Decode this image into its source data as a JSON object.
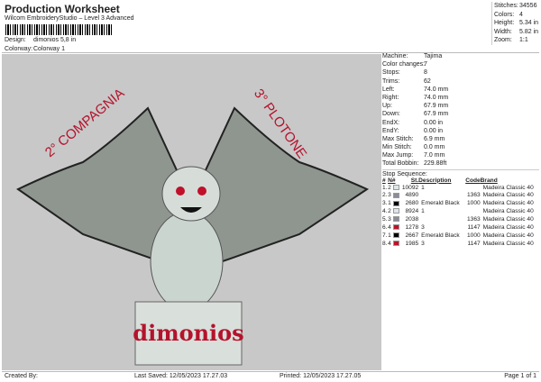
{
  "header": {
    "title": "Production Worksheet",
    "subtitle": "Wilcom EmbroideryStudio – Level 3 Advanced",
    "design_label": "Design:",
    "design": "dimonios 5,8 in",
    "colorway_label": "Colorway:",
    "colorway": "Colorway 1"
  },
  "stats": [
    {
      "k": "Stitches:",
      "v": "34556"
    },
    {
      "k": "Colors:",
      "v": "4"
    },
    {
      "k": "Height:",
      "v": "5.34 in"
    },
    {
      "k": "Width:",
      "v": "5.82 in"
    },
    {
      "k": "Zoom:",
      "v": "1:1"
    }
  ],
  "info": [
    {
      "k": "Machine:",
      "v": "Tajima"
    },
    {
      "k": "Color changes:",
      "v": "7"
    },
    {
      "k": "Stops:",
      "v": "8"
    },
    {
      "k": "Trims:",
      "v": "62"
    },
    {
      "k": "Left:",
      "v": "74.0 mm"
    },
    {
      "k": "Right:",
      "v": "74.0 mm"
    },
    {
      "k": "Up:",
      "v": "67.9 mm"
    },
    {
      "k": "Down:",
      "v": "67.9 mm"
    },
    {
      "k": "EndX:",
      "v": "0.00 in"
    },
    {
      "k": "EndY:",
      "v": "0.00 in"
    },
    {
      "k": "Max Stitch:",
      "v": "6.9 mm"
    },
    {
      "k": "Min Stitch:",
      "v": "0.0 mm"
    },
    {
      "k": "Max Jump:",
      "v": "7.0 mm"
    },
    {
      "k": "Total Bobbin:",
      "v": "229.88ft"
    }
  ],
  "stop_sequence": {
    "label": "Stop Sequence:",
    "columns": [
      "#",
      "N#",
      "St.",
      "Description",
      "Code",
      "Brand"
    ],
    "rows": [
      {
        "n": "1.",
        "nn": "2",
        "color": "#dde6ea",
        "st": "10092",
        "desc": "1",
        "code": "",
        "brand": "Madeira Classic 40"
      },
      {
        "n": "2.",
        "nn": "3",
        "color": "#8a8e9a",
        "st": "4890",
        "desc": "",
        "code": "1363",
        "brand": "Madeira Classic 40"
      },
      {
        "n": "3.",
        "nn": "1",
        "color": "#000000",
        "st": "2680",
        "desc": "Emerald Black",
        "code": "1000",
        "brand": "Madeira Classic 40"
      },
      {
        "n": "4.",
        "nn": "2",
        "color": "#dde6ea",
        "st": "8924",
        "desc": "1",
        "code": "",
        "brand": "Madeira Classic 40"
      },
      {
        "n": "5.",
        "nn": "3",
        "color": "#8a8e9a",
        "st": "2038",
        "desc": "",
        "code": "1363",
        "brand": "Madeira Classic 40"
      },
      {
        "n": "6.",
        "nn": "4",
        "color": "#c0102a",
        "st": "1278",
        "desc": "3",
        "code": "1147",
        "brand": "Madeira Classic 40"
      },
      {
        "n": "7.",
        "nn": "1",
        "color": "#000000",
        "st": "2667",
        "desc": "Emerald Black",
        "code": "1000",
        "brand": "Madeira Classic 40"
      },
      {
        "n": "8.",
        "nn": "4",
        "color": "#c0102a",
        "st": "1985",
        "desc": "3",
        "code": "1147",
        "brand": "Madeira Classic 40"
      }
    ]
  },
  "design_text": {
    "left": "2° COMPAGNIA",
    "right": "3° PLOTONE",
    "base": "dimonios"
  },
  "footer": {
    "created": "Created By:",
    "saved": "Last Saved: 12/05/2023 17.27.03",
    "printed": "Printed: 12/05/2023 17.27.05",
    "page": "Page 1 of 1"
  }
}
